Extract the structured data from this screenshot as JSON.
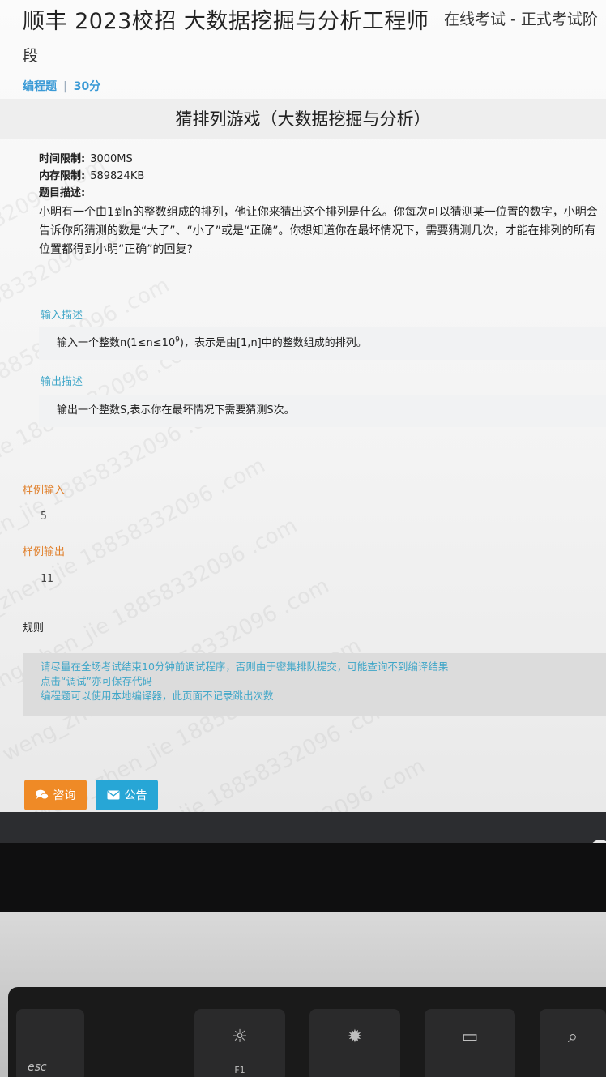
{
  "header": {
    "exam_title": "顺丰 2023校招 大数据挖掘与分析工程师",
    "exam_mode": "在线考试 - 正式考试阶",
    "exam_title_wrap": "段"
  },
  "question_meta": {
    "type": "编程题",
    "separator": "|",
    "score": "30分"
  },
  "question": {
    "title": "猜排列游戏（大数据挖掘与分析）",
    "time_limit_label": "时间限制:",
    "time_limit": "3000MS",
    "memory_limit_label": "内存限制:",
    "memory_limit": "589824KB",
    "desc_label": "题目描述:",
    "description": "小明有一个由1到n的整数组成的排列，他让你来猜出这个排列是什么。你每次可以猜测某一位置的数字，小明会告诉你所猜测的数是“大了”、“小了”或是“正确”。你想知道你在最坏情况下，需要猜测几次，才能在排列的所有位置都得到小明“正确”的回复?"
  },
  "input_section": {
    "label": "输入描述",
    "text_before": "输入一个整数n(1≤n≤10",
    "exponent": "9",
    "text_after": ")，表示是由[1,n]中的整数组成的排列。"
  },
  "output_section": {
    "label": "输出描述",
    "text": "输出一个整数S,表示你在最坏情况下需要猜测S次。"
  },
  "samples": {
    "input_label": "样例输入",
    "input_value": "5",
    "output_label": "样例输出",
    "output_value": "11"
  },
  "rules": {
    "heading": "规则",
    "lines": [
      "请尽量在全场考试结束10分钟前调试程序，否则由于密集排队提交，可能查询不到编译结果",
      "点击“调试”亦可保存代码",
      "编程题可以使用本地编译器，此页面不记录跳出次数"
    ]
  },
  "buttons": {
    "consult_label": "咨询",
    "consult_icon": "chat-bubbles-icon",
    "notice_label": "公告",
    "notice_icon": "envelope-icon"
  },
  "watermark": {
    "text": "weng_zhen_jie 18858332096 .com"
  },
  "keyboard": {
    "esc_label": "esc",
    "f1_label": "F1",
    "f1_icon": "brightness-low-icon",
    "f2_icon": "brightness-high-icon",
    "f3_icon": "mission-control-icon",
    "f4_icon": "search-icon"
  },
  "colors": {
    "accent_blue": "#3fa6c8",
    "sample_orange": "#e07f2a",
    "consult_button": "#ef8a26",
    "notice_button": "#27a6d6"
  }
}
